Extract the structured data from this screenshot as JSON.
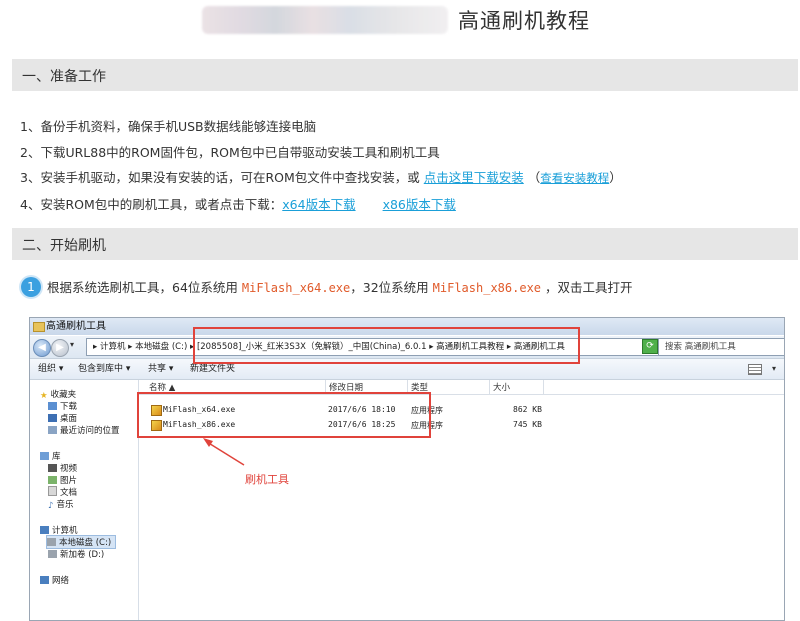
{
  "page": {
    "title": "高通刷机教程"
  },
  "sections": [
    {
      "label": "一、准备工作"
    },
    {
      "label": "二、开始刷机"
    }
  ],
  "prep_steps": {
    "s1": "1、备份手机资料，确保手机USB数据线能够连接电脑",
    "s2": "2、下载URL88中的ROM固件包，ROM包中已自带驱动安装工具和刷机工具",
    "s3_prefix": "3、安装手机驱动，如果没有安装的话，可在ROM包文件中查找安装，或 ",
    "s3_link": "点击这里下载安装",
    "s3_paren_open": "  （",
    "s3_tutorial_link": "查看安装教程",
    "s3_paren_close": "）",
    "s4_prefix": "4、安装ROM包中的刷机工具，或者点击下载：",
    "s4_link_x64": "x64版本下载",
    "s4_link_x86": "x86版本下载"
  },
  "step1": {
    "badge": "1",
    "text_a": "根据系统选刷机工具，64位系统用 ",
    "code_a": "MiFlash_x64.exe",
    "text_b": "，32位系统用 ",
    "code_b": "MiFlash_x86.exe",
    "text_c": " ，双击工具打开"
  },
  "explorer": {
    "window_title": "高通刷机工具",
    "address": "▸ 计算机 ▸ 本地磁盘 (C:) ▸ [2085508]_小米_红米3S3X（免解锁）_中国(China)_6.0.1 ▸ 高通刷机工具教程 ▸ 高通刷机工具",
    "search_placeholder": "搜索 高通刷机工具",
    "toolbar": {
      "organize": "组织 ▾",
      "include_in_library": "包含到库中 ▾",
      "share": "共享 ▾",
      "new_folder": "新建文件夹"
    },
    "nav": {
      "favorites": "收藏夹",
      "downloads": "下载",
      "desktop": "桌面",
      "recent": "最近访问的位置",
      "libraries": "库",
      "videos": "视频",
      "pictures": "图片",
      "documents": "文档",
      "music": "音乐",
      "computer": "计算机",
      "local_disk": "本地磁盘 (C:)",
      "new_volume": "新加卷 (D:)",
      "network": "网络"
    },
    "columns": {
      "name": "名称 ▲",
      "modified": "修改日期",
      "type": "类型",
      "size": "大小"
    },
    "files": [
      {
        "name": "MiFlash_x64.exe",
        "modified": "2017/6/6 18:10",
        "type": "应用程序",
        "size": "862 KB"
      },
      {
        "name": "MiFlash_x86.exe",
        "modified": "2017/6/6 18:25",
        "type": "应用程序",
        "size": "745 KB"
      }
    ],
    "annotation": "刷机工具"
  },
  "colors": {
    "link": "#1a9fd8",
    "code": "#e05a2a",
    "highlight_box": "#e0433b",
    "section_bg": "#e6e6e6"
  }
}
